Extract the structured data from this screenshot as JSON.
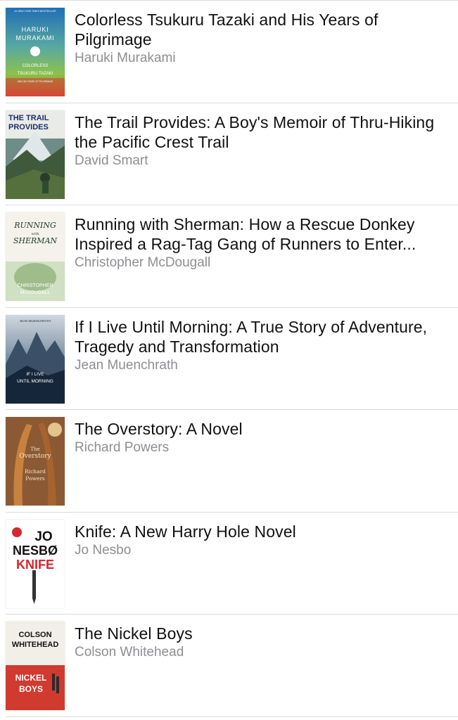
{
  "books": [
    {
      "title": "Colorless Tsukuru Tazaki and His Years of Pilgrimage",
      "author": "Haruki Murakami",
      "cover": {
        "top_text": "#1 NEW YORK TIMES BESTSELLER",
        "line1": "HARUKI",
        "line2": "MURAKAMI",
        "line3": "COLORLESS",
        "line4": "TSUKURU TAZAKI",
        "line5": "AND HIS YEARS OF PILGRIMAGE"
      }
    },
    {
      "title": "The Trail Provides: A Boy's Memoir of Thru-Hiking the Pacific Crest Trail",
      "author": "David Smart",
      "cover": {
        "line1": "THE TRAIL",
        "line2": "PROVIDES"
      }
    },
    {
      "title": "Running with Sherman: How a Rescue Donkey Inspired a Rag-Tag Gang of Runners to Enter...",
      "author": "Christopher McDougall",
      "cover": {
        "line1": "RUNNING",
        "line2": "with",
        "line3": "SHERMAN",
        "line4": "CHRISTOPHER",
        "line5": "McDOUGALL"
      }
    },
    {
      "title": "If I Live Until Morning: A True Story of Adventure, Tragedy and Transformation",
      "author": "Jean Muenchrath",
      "cover": {
        "line1": "JEAN MUENCHRATH",
        "line2": "IF I LIVE",
        "line3": "UNTIL MORNING"
      }
    },
    {
      "title": "The Overstory: A Novel",
      "author": "Richard Powers",
      "cover": {
        "line1": "The",
        "line2": "Overstory",
        "line3": "Richard",
        "line4": "Powers"
      }
    },
    {
      "title": "Knife: A New Harry Hole Novel",
      "author": "Jo Nesbo",
      "cover": {
        "line1": "JO",
        "line2": "NESBØ",
        "line3": "KNIFE"
      }
    },
    {
      "title": "The Nickel Boys",
      "author": "Colson Whitehead",
      "cover": {
        "line1": "COLSON",
        "line2": "WHITEHEAD",
        "line3": "NICKEL",
        "line4": "BOYS"
      }
    }
  ]
}
